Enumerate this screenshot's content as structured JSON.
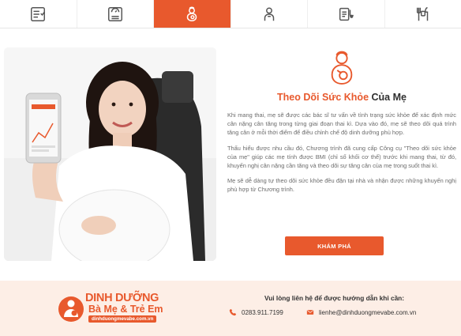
{
  "tabs": [
    {
      "icon": "checklist-icon",
      "active": false
    },
    {
      "icon": "scale-icon",
      "active": false
    },
    {
      "icon": "pregnant-mother-icon",
      "active": true
    },
    {
      "icon": "baby-icon",
      "active": false
    },
    {
      "icon": "stethoscope-icon",
      "active": false
    },
    {
      "icon": "meal-24h-icon",
      "active": false
    }
  ],
  "section": {
    "title_main": "Theo Dõi Sức Khỏe",
    "title_accent": "Của Mẹ",
    "paragraphs": [
      "Khi mang thai, mẹ sẽ được các bác sĩ tư vấn về tình trạng sức khỏe để xác định mức cân nặng cân tăng trong từng giai đoạn thai kì. Dựa vào đó, mẹ sẽ theo dõi quá trình tăng cân ở mỗi thời điểm để điều chỉnh chế độ dinh dưỡng phù hợp.",
      "Thấu hiểu được nhu cầu đó, Chương trình đã cung cấp Công cụ \"Theo dõi sức khỏe của mẹ\" giúp các mẹ tính được BMI (chỉ số khối cơ thể) trước khi mang thai, từ đó, khuyến nghị cân nặng cần tăng và theo dõi sự tăng cân của mẹ trong suốt thai kì.",
      "Mẹ sẽ dễ dàng tự theo dõi sức khỏe đều đặn tại nhà và nhận được những khuyến nghị phù hợp từ Chương trình."
    ],
    "button_label": "KHÁM PHÁ"
  },
  "footer": {
    "logo_line1": "DINH DƯỠNG",
    "logo_line2": "Bà Mẹ",
    "logo_amp": "&",
    "logo_line3": "Trẻ Em",
    "logo_site": "dinhduongmevabe.com.vn",
    "contact_title": "Vui lòng liên hệ để được hướng dẫn khi cần:",
    "phone": "0283.911.7199",
    "email": "lienhe@dinhduongmevabe.com.vn"
  },
  "colors": {
    "accent": "#e8592d",
    "footer_bg": "#fdeee6"
  }
}
